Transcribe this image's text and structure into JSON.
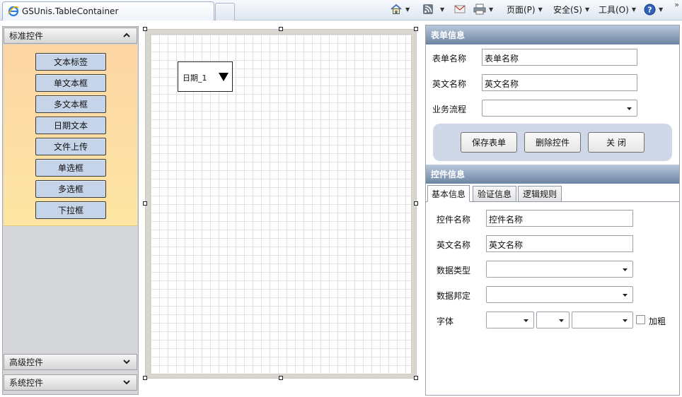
{
  "browser": {
    "tab_title": "GSUnis.TableContainer",
    "menu_page": "页面(P)",
    "menu_safety": "安全(S)",
    "menu_tools": "工具(O)",
    "more_label": "»",
    "icons": [
      "ie-icon",
      "home-icon",
      "rss-icon",
      "mail-icon",
      "print-icon",
      "help-icon"
    ]
  },
  "toolbox": {
    "standard_header": "标准控件",
    "items": [
      "文本标签",
      "单文本框",
      "多文本框",
      "日期文本",
      "文件上传",
      "单选框",
      "多选框",
      "下拉框"
    ],
    "advanced_header": "高级控件",
    "system_header": "系统控件"
  },
  "canvas": {
    "date_control_label": "日期_1"
  },
  "form_info": {
    "header": "表单信息",
    "form_name_label": "表单名称",
    "form_name_value": "表单名称",
    "english_name_label": "英文名称",
    "english_name_value": "英文名称",
    "workflow_label": "业务流程",
    "workflow_value": "",
    "save_button": "保存表单",
    "delete_button": "删除控件",
    "close_button": "关 闭"
  },
  "control_info": {
    "header": "控件信息",
    "tabs": [
      "基本信息",
      "验证信息",
      "逻辑规则"
    ],
    "active_tab": 0,
    "control_name_label": "控件名称",
    "control_name_value": "控件名称",
    "english_name_label": "英文名称",
    "english_name_value": "英文名称",
    "data_type_label": "数据类型",
    "data_type_value": "",
    "data_binding_label": "数据邦定",
    "data_binding_value": "",
    "font_label": "字体",
    "bold_label": "加粗",
    "bold_checked": false
  },
  "colors": {
    "section_header": "#6c84a3",
    "toolbox_bg": "#fcd5a4",
    "tool_button": "#c5d4e8",
    "action_group": "#d0d8e8"
  }
}
